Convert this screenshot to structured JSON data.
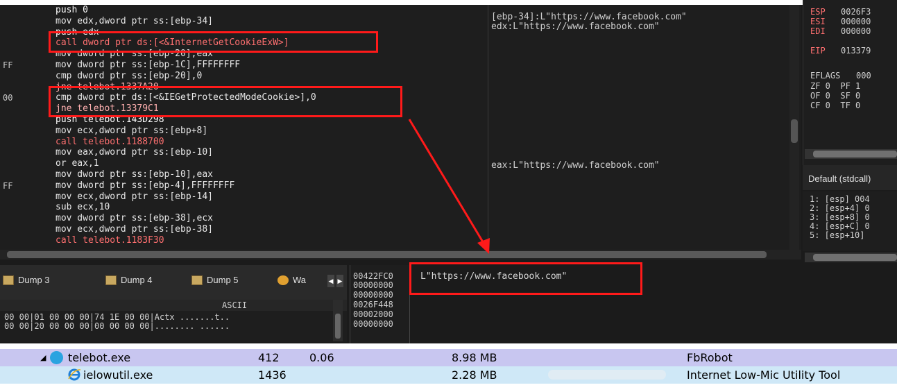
{
  "disasm": {
    "lines": [
      {
        "addr": "",
        "text": "push 0"
      },
      {
        "addr": "",
        "text": "mov edx,dword ptr ss:[ebp-34]"
      },
      {
        "addr": "",
        "text": "push edx"
      },
      {
        "addr": "",
        "text": "call dword ptr ds:[<&InternetGetCookieExW>]"
      },
      {
        "addr": "",
        "text": "mov dword ptr ss:[ebp-20],eax"
      },
      {
        "addr": "FF",
        "text": "mov dword ptr ss:[ebp-1C],FFFFFFFF"
      },
      {
        "addr": "",
        "text": "cmp dword ptr ss:[ebp-20],0"
      },
      {
        "addr": "",
        "text": "jne telebot.1337A20"
      },
      {
        "addr": "00",
        "text": "cmp dword ptr ds:[<&IEGetProtectedModeCookie>],0"
      },
      {
        "addr": "",
        "text": "jne telebot.13379C1"
      },
      {
        "addr": "",
        "text": "push telebot.143D298"
      },
      {
        "addr": "",
        "text": "mov ecx,dword ptr ss:[ebp+8]"
      },
      {
        "addr": "",
        "text": "call telebot.1188700"
      },
      {
        "addr": "",
        "text": "mov eax,dword ptr ss:[ebp-10]"
      },
      {
        "addr": "",
        "text": "or eax,1"
      },
      {
        "addr": "",
        "text": "mov dword ptr ss:[ebp-10],eax"
      },
      {
        "addr": "FF",
        "text": "mov dword ptr ss:[ebp-4],FFFFFFFF"
      },
      {
        "addr": "",
        "text": "mov ecx,dword ptr ss:[ebp-14]"
      },
      {
        "addr": "",
        "text": "sub ecx,10"
      },
      {
        "addr": "",
        "text": "mov dword ptr ss:[ebp-38],ecx"
      },
      {
        "addr": "",
        "text": "mov ecx,dword ptr ss:[ebp-38]"
      },
      {
        "addr": "",
        "text": "call telebot.1183F30"
      }
    ],
    "comments": {
      "c1": "[ebp-34]:L\"https://www.facebook.com\"",
      "c2": "edx:L\"https://www.facebook.com\"",
      "c3": "eax:L\"https://www.facebook.com\""
    }
  },
  "registers": {
    "esp_name": "ESP",
    "esp_val": "0026F3",
    "esi_name": "ESI",
    "esi_val": "000000",
    "edi_name": "EDI",
    "edi_val": "000000",
    "eip_name": "EIP",
    "eip_val": "013379",
    "eflags_label": "EFLAGS",
    "eflags_val": "000",
    "flags1": "ZF 0  PF 1",
    "flags2": "OF 0  SF 0",
    "flags3": "CF 0  TF 0"
  },
  "callconv": "Default (stdcall)",
  "stack_args": [
    "1: [esp] 004",
    "2: [esp+4] 0",
    "3: [esp+8] 0",
    "4: [esp+C] 0",
    "5: [esp+10]"
  ],
  "tabs": {
    "dump3": "Dump 3",
    "dump4": "Dump 4",
    "dump5": "Dump 5",
    "watch": "Wa"
  },
  "dump": {
    "ascii_header": "ASCII",
    "row1": "00 00|01 00 00 00|74 1E 00 00|Actx .......t..",
    "row2": "00 00|20 00 00 00|00 00 00 00|........ ......"
  },
  "stack": [
    "00422FC0",
    "00000000",
    "00000000",
    "0026F448",
    "00002000",
    "00000000"
  ],
  "value_text": "L\"https://www.facebook.com\"",
  "processes": [
    {
      "name": "telebot.exe",
      "pid": "412",
      "cpu": "0.06",
      "mem": "8.98 MB",
      "desc": "FbRobot"
    },
    {
      "name": "ielowutil.exe",
      "pid": "1436",
      "cpu": "",
      "mem": "2.28 MB",
      "desc": "Internet Low-Mic Utility Tool"
    }
  ]
}
